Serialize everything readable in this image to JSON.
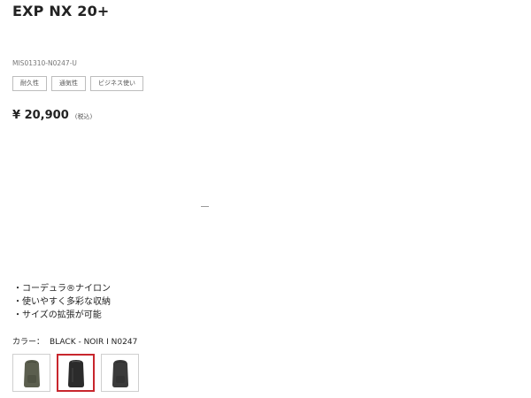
{
  "product": {
    "title": "EXP NX 20+",
    "sku": "MIS01310-N0247-U",
    "tags": [
      "耐久性",
      "通気性",
      "ビジネス使い"
    ],
    "price": "¥ 20,900",
    "tax_note": "(税込)",
    "features": [
      "コーデュラ®ナイロン",
      "使いやすく多彩な収納",
      "サイズの拡張が可能"
    ],
    "feature_bullet": "・",
    "color_label": "カラー：",
    "color_value": "BLACK - NOIR I N0247",
    "swatches": [
      {
        "name": "olive",
        "color": "#5b5e4e",
        "selected": false
      },
      {
        "name": "black",
        "color": "#2b2b2b",
        "selected": true
      },
      {
        "name": "dark-grey",
        "color": "#3a3a3a",
        "selected": false
      }
    ]
  },
  "colors": {
    "selected_border": "#c8262d",
    "swatch_border": "#cfcfcf",
    "tag_border": "#bdbdbd"
  }
}
